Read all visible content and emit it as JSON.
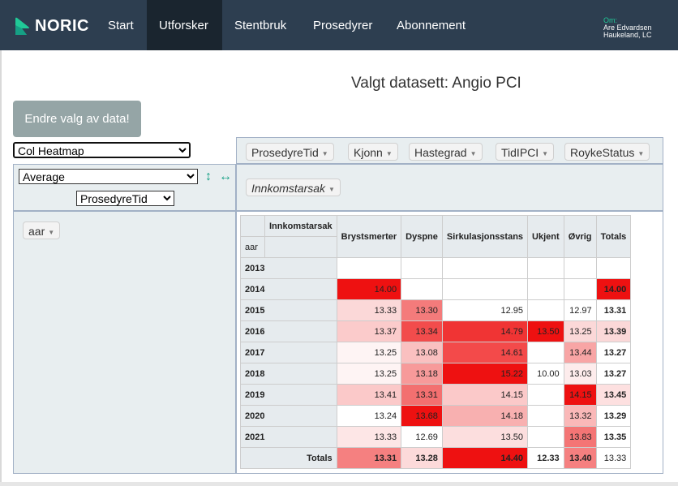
{
  "navbar": {
    "brand": "NORIC",
    "items": [
      {
        "label": "Start",
        "active": false
      },
      {
        "label": "Utforsker",
        "active": true
      },
      {
        "label": "Stentbruk",
        "active": false
      },
      {
        "label": "Prosedyrer",
        "active": false
      },
      {
        "label": "Abonnement",
        "active": false
      }
    ],
    "user": {
      "om": "Om:",
      "name": "Are Edvardsen",
      "org": "Haukeland, LC"
    },
    "colors": {
      "bg": "#2d3e50",
      "active_bg": "#1a252f",
      "accent": "#20c997"
    }
  },
  "dataset_title": "Valgt datasett: Angio PCI",
  "endre_button": "Endre valg av data!",
  "renderer": {
    "selected": "Col Heatmap"
  },
  "aggregator": {
    "selected": "Average",
    "field": "ProsedyreTid"
  },
  "icons": {
    "sort_rows": "vertical-arrows-icon",
    "sort_cols": "horizontal-arrows-icon"
  },
  "unused_attributes": [
    "ProsedyreTid",
    "Kjonn",
    "Hastegrad",
    "TidIPCI",
    "RoykeStatus"
  ],
  "col_attributes": [
    "Innkomstarsak"
  ],
  "row_attributes": [
    "aar"
  ],
  "table": {
    "col_attr_label": "Innkomstarsak",
    "row_attr_label": "aar",
    "columns": [
      "Brystsmerter",
      "Dyspne",
      "Sirkulasjonsstans",
      "Ukjent",
      "Øvrig",
      "Totals"
    ],
    "rows": [
      {
        "label": "2013",
        "cells": [
          "",
          "",
          "",
          "",
          "",
          ""
        ]
      },
      {
        "label": "2014",
        "cells": [
          "14.00",
          "",
          "",
          "",
          "",
          "14.00"
        ]
      },
      {
        "label": "2015",
        "cells": [
          "13.33",
          "13.30",
          "12.95",
          "",
          "12.97",
          "13.31"
        ]
      },
      {
        "label": "2016",
        "cells": [
          "13.37",
          "13.34",
          "14.79",
          "13.50",
          "13.25",
          "13.39"
        ]
      },
      {
        "label": "2017",
        "cells": [
          "13.25",
          "13.08",
          "14.61",
          "",
          "13.44",
          "13.27"
        ]
      },
      {
        "label": "2018",
        "cells": [
          "13.25",
          "13.18",
          "15.22",
          "10.00",
          "13.03",
          "13.27"
        ]
      },
      {
        "label": "2019",
        "cells": [
          "13.41",
          "13.31",
          "14.15",
          "",
          "14.15",
          "13.45"
        ]
      },
      {
        "label": "2020",
        "cells": [
          "13.24",
          "13.68",
          "14.18",
          "",
          "13.32",
          "13.29"
        ]
      },
      {
        "label": "2021",
        "cells": [
          "13.33",
          "12.69",
          "13.50",
          "",
          "13.83",
          "13.35"
        ]
      }
    ],
    "totals": {
      "label": "Totals",
      "cells": [
        "13.31",
        "13.28",
        "14.40",
        "12.33",
        "13.40",
        "13.33"
      ]
    },
    "row_cell_colors": [
      [
        "#ffffff",
        "#ffffff",
        "#ffffff",
        "#ffffff",
        "#ffffff",
        "#ffffff"
      ],
      [
        "#ee1111",
        "#ffffff",
        "#ffffff",
        "#ffffff",
        "#ffffff",
        "#ee1111"
      ],
      [
        "#fbd8d8",
        "#f47b7b",
        "#ffffff",
        "#ffffff",
        "#ffffff",
        "#ffffff"
      ],
      [
        "#fbcbcb",
        "#f24c4c",
        "#f03434",
        "#ee1111",
        "#fbd8d8",
        "#fbd8d8"
      ],
      [
        "#fef4f4",
        "#fac0c0",
        "#f34a4a",
        "#ffffff",
        "#f8a5a5",
        "#ffffff"
      ],
      [
        "#fef4f4",
        "#f79a9a",
        "#ee1111",
        "#ffffff",
        "#fdecec",
        "#ffffff"
      ],
      [
        "#fbc9c9",
        "#f37070",
        "#fbc9c9",
        "#ffffff",
        "#ee1111",
        "#fde0e0"
      ],
      [
        "#ffffff",
        "#ee1111",
        "#f8b0b0",
        "#ffffff",
        "#fab8b8",
        "#ffffff"
      ],
      [
        "#fde6e6",
        "#ffffff",
        "#fcdede",
        "#ffffff",
        "#f47575",
        "#ffffff"
      ]
    ],
    "totals_colors": [
      "#f58080",
      "#fcdada",
      "#ee1111",
      "#ffffff",
      "#f58080",
      "#ffffff"
    ]
  }
}
